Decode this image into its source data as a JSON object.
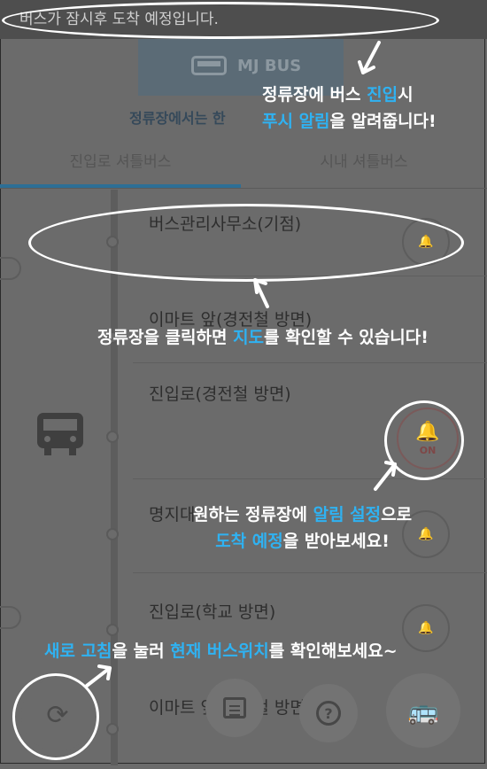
{
  "notification": {
    "text": "버스가 잠시후 도착 예정입니다."
  },
  "brand": {
    "label": "MJ BUS"
  },
  "info_note": {
    "text": "정류장에서는 한"
  },
  "tabs": [
    {
      "label": "진입로 셔틀버스",
      "active": true
    },
    {
      "label": "시내 셔틀버스",
      "active": false
    }
  ],
  "stops": [
    {
      "name": "버스관리사무소(기점)"
    },
    {
      "name": "이마트 앞(경전철 방면)"
    },
    {
      "name": "진입로(경전철 방면)"
    },
    {
      "name": "명지대"
    },
    {
      "name": "진입로(학교 방면)"
    },
    {
      "name": "이마트 앞(경전철 방면)"
    }
  ],
  "alarm_on_label": "ON",
  "icons": {
    "alarm": "bell-icon",
    "refresh": "refresh-icon",
    "calendar": "calendar-icon",
    "help": "help-icon",
    "bus": "bus-icon"
  },
  "help_glyph": "?",
  "refresh_glyph": "⟳",
  "tips": {
    "push": {
      "p1": "정류장에 버스 ",
      "h1": "진입",
      "p2": "시",
      "h2": "푸시 알림",
      "p3": "을 알려줍니다!"
    },
    "map": {
      "p1": "정류장을 클릭하면 ",
      "h1": "지도",
      "p2": "를 확인할 수 있습니다!"
    },
    "alarm": {
      "p1": "원하는 정류장에 ",
      "h1": "알림 설정",
      "p2": "으로",
      "h2": "도착 예정",
      "p3": "을 받아보세요!"
    },
    "refresh": {
      "h1": "새로 고침",
      "p1": "을 눌러 ",
      "h2": "현재 버스위치",
      "p2": "를 확인해보세요~"
    }
  },
  "colors": {
    "overlay": "#6b6b6b",
    "highlight": "#2fb2f2",
    "tip_text": "#ffffff",
    "tab_accent": "#2d6f96"
  }
}
